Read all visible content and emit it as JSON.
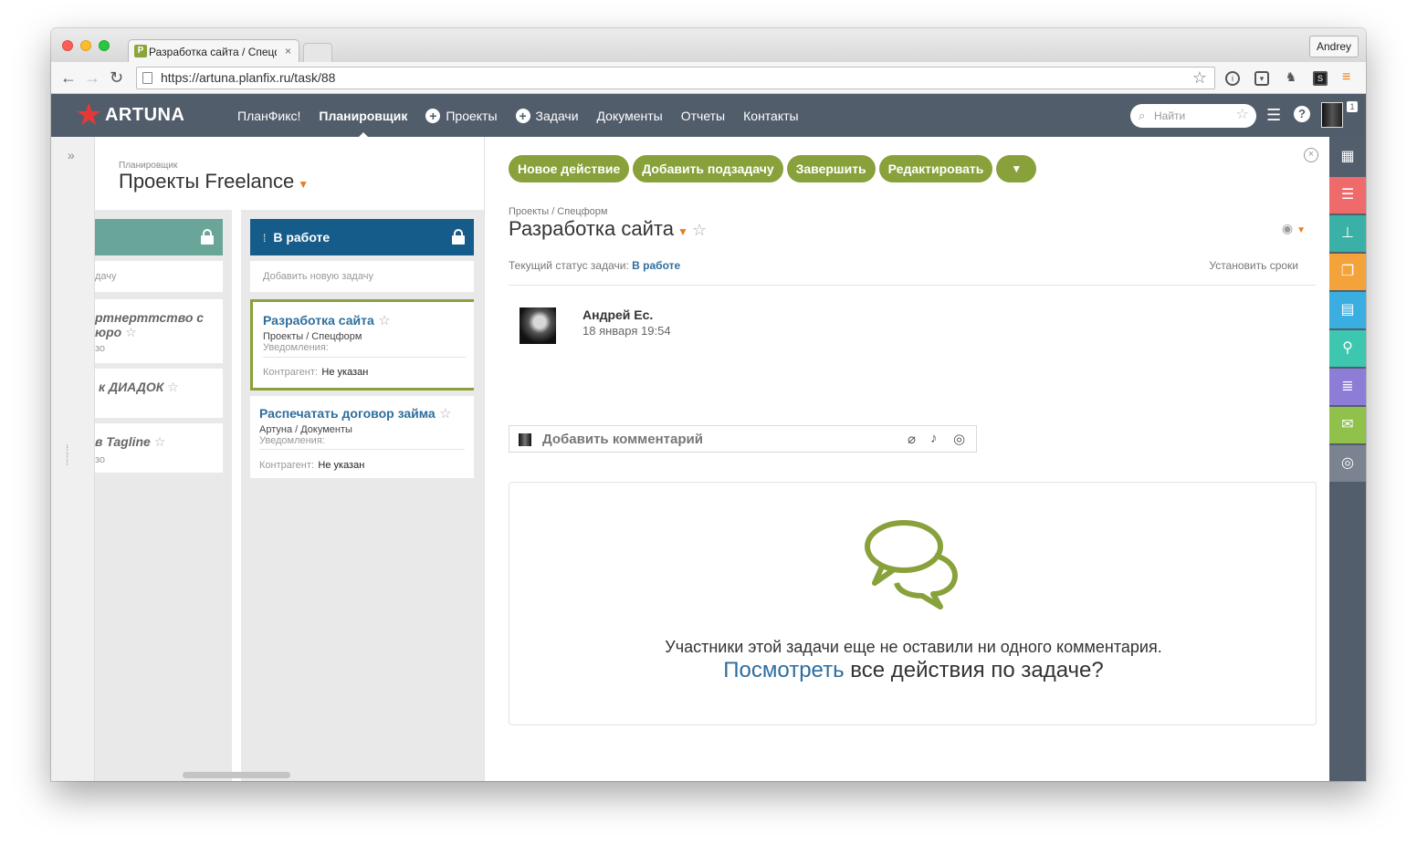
{
  "browser": {
    "tab_title": "Разработка сайта / Спецформ",
    "tab_close": "×",
    "user_label": "Andrey",
    "url": "https://artuna.planfix.ru/task/88"
  },
  "app": {
    "logo_text": "ARTUNA",
    "nav": [
      {
        "label": "ПланФикс!",
        "plus": false,
        "active": false
      },
      {
        "label": "Планировщик",
        "plus": false,
        "active": true
      },
      {
        "label": "Проекты",
        "plus": true,
        "active": false
      },
      {
        "label": "Задачи",
        "plus": true,
        "active": false
      },
      {
        "label": "Документы",
        "plus": false,
        "active": false
      },
      {
        "label": "Отчеты",
        "plus": false,
        "active": false
      },
      {
        "label": "Контакты",
        "plus": false,
        "active": false
      }
    ],
    "search_placeholder": "Найти",
    "notifications_badge": "1"
  },
  "planner": {
    "breadcrumb": "Планировщик",
    "title": "Проекты Freelance",
    "col_a": {
      "add_task_partial": "дачу",
      "cards": [
        {
          "title_line1": "ртнерттство с",
          "title_line2": "юро",
          "meta": "зо"
        },
        {
          "title_line1": "к ДИАДОК"
        },
        {
          "title_line1": "в Tagline",
          "meta": "зо"
        }
      ]
    },
    "col_b": {
      "title": "В работе",
      "add_task": "Добавить новую задачу",
      "cards": [
        {
          "title": "Разработка сайта",
          "project": "Проекты / Спецформ",
          "notify": "Уведомления:",
          "contragent_label": "Контрагент:",
          "contragent_value": "Не указан"
        },
        {
          "title": "Распечатать договор займа",
          "project": "Артуна / Документы",
          "notify": "Уведомления:",
          "contragent_label": "Контрагент:",
          "contragent_value": "Не указан"
        }
      ]
    }
  },
  "task": {
    "actions": [
      "Новое действие",
      "Добавить подзадачу",
      "Завершить",
      "Редактировать"
    ],
    "breadcrumb": "Проекты / Спецформ",
    "title": "Разработка сайта",
    "status_label": "Текущий статус задачи:",
    "status_value": "В работе",
    "set_dates": "Установить сроки",
    "author_name": "Андрей Ес.",
    "author_date": "18 января 19:54",
    "comment_placeholder": "Добавить комментарий",
    "empty_line1": "Участники этой задачи еще не оставили ни одного комментария.",
    "empty_link": "Посмотреть",
    "empty_rest": " все действия по задаче?"
  },
  "dock_colors": [
    "#535e6d",
    "#ef6b6b",
    "#3ab0a6",
    "#f4a33b",
    "#3aaee0",
    "#3ec7b0",
    "#8d7dd6",
    "#8fc14b",
    "#7a838f"
  ],
  "icons": [
    "calendar-icon",
    "list-icon",
    "structure-icon",
    "copy-icon",
    "document-icon",
    "tools-icon",
    "layers-icon",
    "mail-icon",
    "planfix-icon"
  ]
}
